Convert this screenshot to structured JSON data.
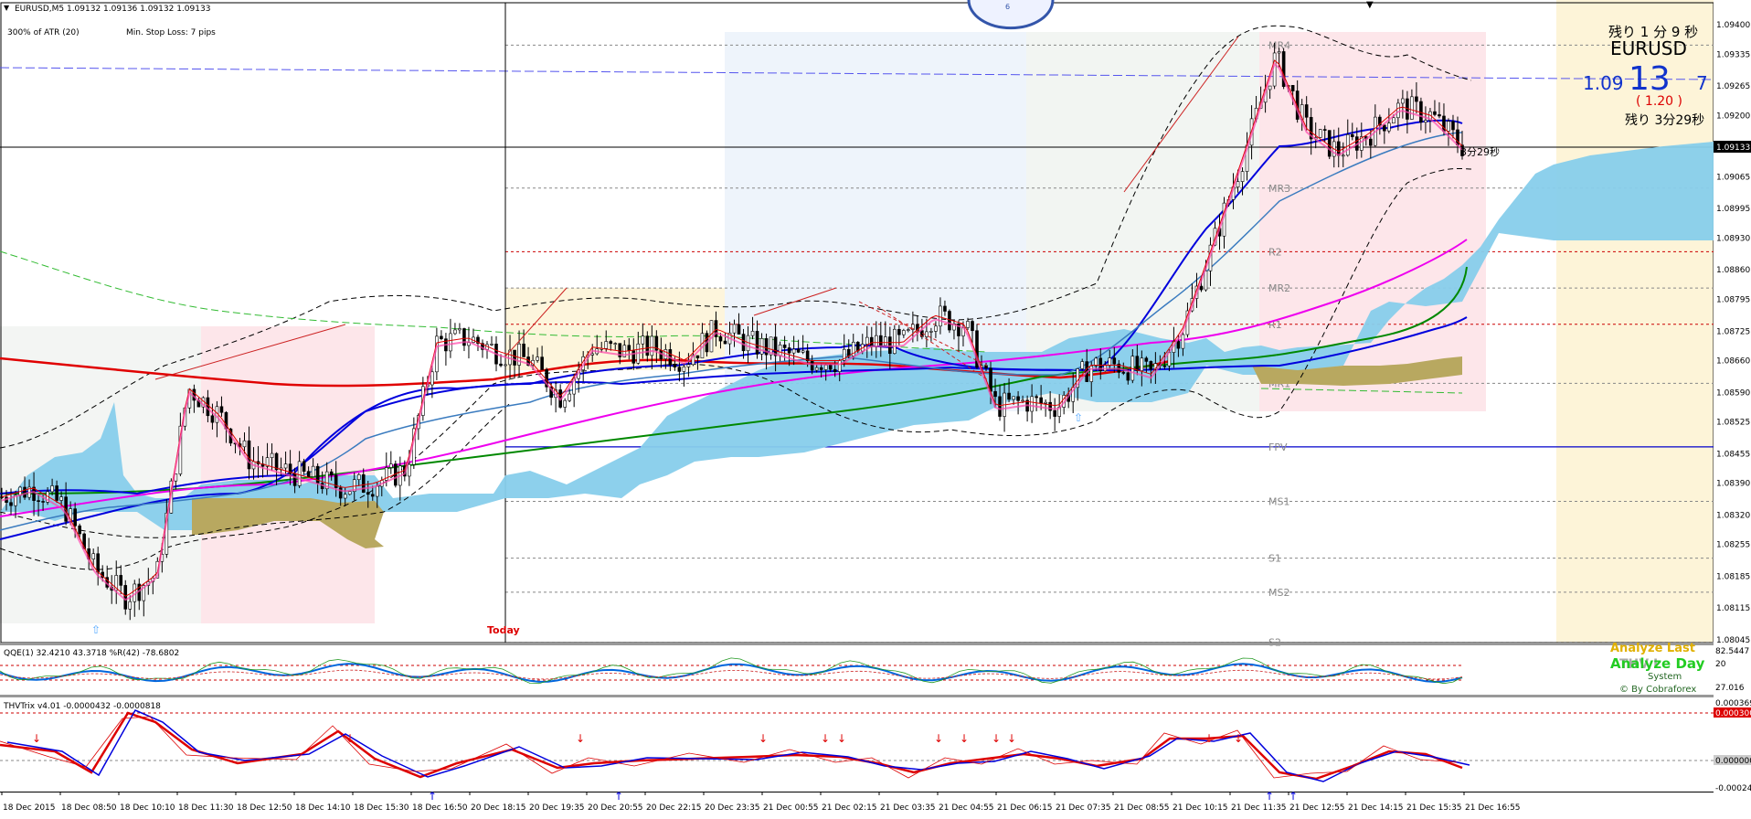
{
  "header": {
    "symbol_title": "EURUSD,M5  1.09132 1.09136 1.09132 1.09133",
    "atr_label": "300% of ATR (20)",
    "stop_label": "Min. Stop Loss:  7 pips"
  },
  "today_label": "Today",
  "info_panel": {
    "remaining_top": "残り 1 分 9 秒",
    "symbol": "EURUSD",
    "price_prefix": "1.09",
    "price_big": "13",
    "price_last": "7",
    "change": "( 1.20 )",
    "remaining_bottom": "残り 3分29秒",
    "current_marker": "3分29秒"
  },
  "price_axis": {
    "labels": [
      "1.09400",
      "1.09335",
      "1.09265",
      "1.09200",
      "1.09065",
      "1.08995",
      "1.08930",
      "1.08860",
      "1.08795",
      "1.08725",
      "1.08660",
      "1.08590",
      "1.08525",
      "1.08455",
      "1.08390",
      "1.08320",
      "1.08255",
      "1.08185",
      "1.08115",
      "1.08045"
    ],
    "current_price": "1.09133"
  },
  "pivots": [
    {
      "label": "MR4",
      "value": 1.09355,
      "color": "#888888"
    },
    {
      "label": "MR3",
      "value": 1.0904,
      "color": "#888888"
    },
    {
      "label": "R2",
      "value": 1.089,
      "color": "#cc0000"
    },
    {
      "label": "MR2",
      "value": 1.0882,
      "color": "#888888"
    },
    {
      "label": "R1",
      "value": 1.0874,
      "color": "#cc0000"
    },
    {
      "label": "MR1",
      "value": 1.0861,
      "color": "#888888"
    },
    {
      "label": "FPV",
      "value": 1.0847,
      "color": "#0000cc"
    },
    {
      "label": "MS1",
      "value": 1.0835,
      "color": "#888888"
    },
    {
      "label": "S1",
      "value": 1.08225,
      "color": "#888888"
    },
    {
      "label": "MS2",
      "value": 1.0815,
      "color": "#888888"
    },
    {
      "label": "S2",
      "value": 1.0804,
      "color": "#888888"
    }
  ],
  "oscillator1": {
    "title": "QQE(1) 32.4210 43.3718  %R(42) -78.6802",
    "scale_top": "82.5447",
    "scale_mid": "20",
    "scale_bottom": "27.016",
    "overlay_title": "Analyze Day",
    "overlay_sub": "System",
    "overlay_credit": "© By Cobraforex",
    "overlay_hidden": "Analyze Last",
    "overlay_hidden2": "THV I"
  },
  "oscillator2": {
    "title": "THVTrix v4.01 -0.0000432 -0.0000818",
    "scale_top": "0.000369",
    "scale_high": "0.000300",
    "scale_zero": "0.000000",
    "scale_bottom": "-0.000244"
  },
  "time_axis": [
    "18 Dec 2015",
    "18 Dec 08:50",
    "18 Dec 10:10",
    "18 Dec 11:30",
    "18 Dec 12:50",
    "18 Dec 14:10",
    "18 Dec 15:30",
    "18 Dec 16:50",
    "20 Dec 18:15",
    "20 Dec 19:35",
    "20 Dec 20:55",
    "20 Dec 22:15",
    "20 Dec 23:35",
    "21 Dec 00:55",
    "21 Dec 02:15",
    "21 Dec 03:35",
    "21 Dec 04:55",
    "21 Dec 06:15",
    "21 Dec 07:35",
    "21 Dec 08:55",
    "21 Dec 10:15",
    "21 Dec 11:35",
    "21 Dec 12:55",
    "21 Dec 14:15",
    "21 Dec 15:35",
    "21 Dec 16:55"
  ],
  "colors": {
    "ma_red": "#e00000",
    "ma_blue": "#0000dd",
    "ma_green": "#008800",
    "ma_magenta": "#ee00ee",
    "cloud_blue": "#87ceeb",
    "cloud_olive": "#b8a860",
    "candle": "#000000"
  },
  "chart_data": {
    "type": "candlestick",
    "symbol": "EURUSD",
    "timeframe": "M5",
    "ylim": [
      1.08045,
      1.094
    ],
    "last_price": 1.09133,
    "close_path": [
      [
        0,
        1.0836
      ],
      [
        2,
        1.0838
      ],
      [
        4,
        1.0834
      ],
      [
        6,
        1.082
      ],
      [
        8,
        1.0814
      ],
      [
        10,
        1.0819
      ],
      [
        12,
        1.086
      ],
      [
        14,
        1.0854
      ],
      [
        16,
        1.0844
      ],
      [
        18,
        1.0842
      ],
      [
        20,
        1.084
      ],
      [
        22,
        1.0838
      ],
      [
        24,
        1.0839
      ],
      [
        26,
        1.0842
      ],
      [
        28,
        1.087
      ],
      [
        30,
        1.0871
      ],
      [
        32,
        1.0868
      ],
      [
        34,
        1.0866
      ],
      [
        36,
        1.0858
      ],
      [
        38,
        1.0869
      ],
      [
        40,
        1.0868
      ],
      [
        42,
        1.0869
      ],
      [
        44,
        1.0866
      ],
      [
        46,
        1.0873
      ],
      [
        48,
        1.087
      ],
      [
        50,
        1.0868
      ],
      [
        52,
        1.0866
      ],
      [
        54,
        1.0866
      ],
      [
        56,
        1.087
      ],
      [
        58,
        1.087
      ],
      [
        60,
        1.0876
      ],
      [
        62,
        1.0874
      ],
      [
        64,
        1.0856
      ],
      [
        66,
        1.0857
      ],
      [
        68,
        1.0856
      ],
      [
        70,
        1.0865
      ],
      [
        72,
        1.0865
      ],
      [
        74,
        1.0863
      ],
      [
        76,
        1.0873
      ],
      [
        78,
        1.0892
      ],
      [
        80,
        1.0912
      ],
      [
        82,
        1.0933
      ],
      [
        84,
        1.0917
      ],
      [
        86,
        1.0912
      ],
      [
        88,
        1.0916
      ],
      [
        90,
        1.0922
      ],
      [
        92,
        1.092
      ],
      [
        94,
        1.09133
      ]
    ]
  }
}
